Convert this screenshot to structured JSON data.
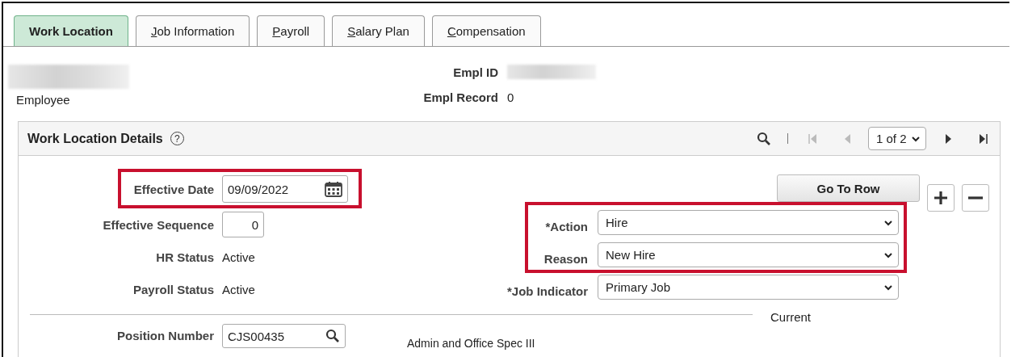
{
  "tabs": [
    {
      "label": "Work Location",
      "selected": true,
      "access_key": false
    },
    {
      "label": "Job Information",
      "selected": false,
      "access_key": true
    },
    {
      "label": "Payroll",
      "selected": false,
      "access_key": true
    },
    {
      "label": "Salary Plan",
      "selected": false,
      "access_key": true
    },
    {
      "label": "Compensation",
      "selected": false,
      "access_key": true
    }
  ],
  "header": {
    "employee": {
      "label": "Employee",
      "kind": "redacted"
    },
    "fields": [
      {
        "label": "Empl ID",
        "kind": "redacted"
      },
      {
        "label": "Empl Record",
        "kind": "text",
        "value": "0"
      }
    ]
  },
  "panel": {
    "title": "Work Location Details",
    "help": "?",
    "pager": {
      "value": "1 of 2"
    },
    "go_to_row": "Go To Row",
    "left_fields": [
      {
        "label": "Effective Date",
        "kind": "date",
        "value": "09/09/2022",
        "highlighted": true
      },
      {
        "label": "Effective Sequence",
        "kind": "number",
        "value": "0",
        "highlighted": false
      },
      {
        "label": "HR Status",
        "kind": "text",
        "value": "Active",
        "highlighted": false
      },
      {
        "label": "Payroll Status",
        "kind": "text",
        "value": "Active",
        "highlighted": false
      }
    ],
    "right_fields": [
      {
        "label": "*Action",
        "kind": "select",
        "value": "Hire",
        "highlighted": true
      },
      {
        "label": "Reason",
        "kind": "select",
        "value": "New Hire",
        "highlighted": true
      },
      {
        "label": "*Job Indicator",
        "kind": "select",
        "value": "Primary Job",
        "highlighted": false
      }
    ],
    "section_label": "Current",
    "position": {
      "label": "Position Number",
      "value": "CJS00435",
      "description": "Admin and Office Spec III"
    }
  }
}
